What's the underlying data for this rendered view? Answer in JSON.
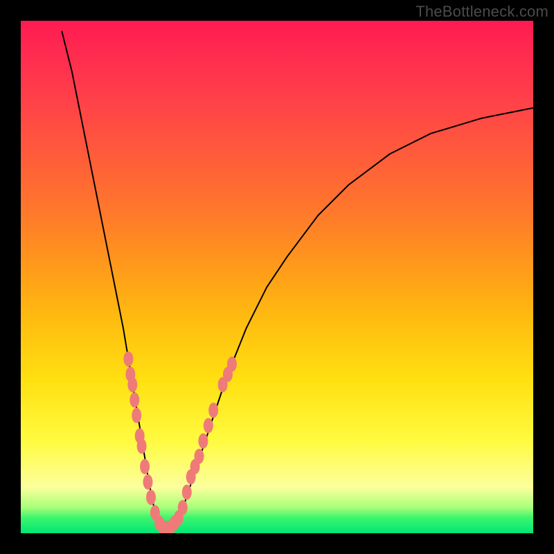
{
  "watermark": "TheBottleneck.com",
  "chart_data": {
    "type": "line",
    "title": "",
    "xlabel": "",
    "ylabel": "",
    "xlim": [
      0,
      100
    ],
    "ylim": [
      0,
      100
    ],
    "series": [
      {
        "name": "bottleneck-curve",
        "x": [
          8,
          10,
          12,
          14,
          16,
          18,
          20,
          21,
          22,
          23,
          24,
          25,
          26,
          27,
          28,
          29,
          30,
          32,
          34,
          36,
          38,
          40,
          44,
          48,
          52,
          58,
          64,
          72,
          80,
          90,
          100
        ],
        "values": [
          98,
          90,
          80,
          70,
          60,
          50,
          40,
          34,
          28,
          22,
          16,
          10,
          5,
          2,
          1,
          1,
          2,
          6,
          12,
          18,
          24,
          30,
          40,
          48,
          54,
          62,
          68,
          74,
          78,
          81,
          83
        ]
      }
    ],
    "markers": [
      {
        "name": "bead",
        "x": 21.0,
        "y": 34
      },
      {
        "name": "bead",
        "x": 21.4,
        "y": 31
      },
      {
        "name": "bead",
        "x": 21.8,
        "y": 29
      },
      {
        "name": "bead",
        "x": 22.2,
        "y": 26
      },
      {
        "name": "bead",
        "x": 22.6,
        "y": 23
      },
      {
        "name": "bead",
        "x": 23.2,
        "y": 19
      },
      {
        "name": "bead",
        "x": 23.6,
        "y": 17
      },
      {
        "name": "bead",
        "x": 24.2,
        "y": 13
      },
      {
        "name": "bead",
        "x": 24.8,
        "y": 10
      },
      {
        "name": "bead",
        "x": 25.4,
        "y": 7
      },
      {
        "name": "bead",
        "x": 26.2,
        "y": 4
      },
      {
        "name": "bead",
        "x": 27.0,
        "y": 2
      },
      {
        "name": "bead",
        "x": 27.8,
        "y": 1
      },
      {
        "name": "bead",
        "x": 28.6,
        "y": 1
      },
      {
        "name": "bead",
        "x": 29.2,
        "y": 1
      },
      {
        "name": "bead",
        "x": 30.0,
        "y": 2
      },
      {
        "name": "bead",
        "x": 30.8,
        "y": 3
      },
      {
        "name": "bead",
        "x": 31.6,
        "y": 5
      },
      {
        "name": "bead",
        "x": 32.4,
        "y": 8
      },
      {
        "name": "bead",
        "x": 33.2,
        "y": 11
      },
      {
        "name": "bead",
        "x": 34.0,
        "y": 13
      },
      {
        "name": "bead",
        "x": 34.8,
        "y": 15
      },
      {
        "name": "bead",
        "x": 35.6,
        "y": 18
      },
      {
        "name": "bead",
        "x": 36.6,
        "y": 21
      },
      {
        "name": "bead",
        "x": 37.6,
        "y": 24
      },
      {
        "name": "bead",
        "x": 39.4,
        "y": 29
      },
      {
        "name": "bead",
        "x": 40.4,
        "y": 31
      },
      {
        "name": "bead",
        "x": 41.2,
        "y": 33
      }
    ],
    "gradient_stops": [
      {
        "pos": 0.0,
        "color": "#ff1a52"
      },
      {
        "pos": 0.5,
        "color": "#ffbb10"
      },
      {
        "pos": 0.85,
        "color": "#fffb40"
      },
      {
        "pos": 1.0,
        "color": "#00e676"
      }
    ]
  }
}
